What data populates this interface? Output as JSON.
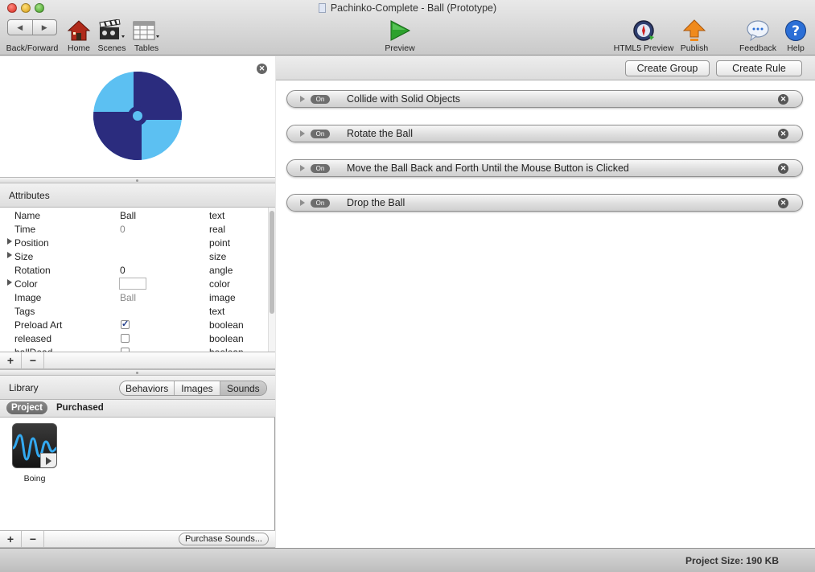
{
  "window": {
    "title": "Pachinko-Complete - Ball (Prototype)"
  },
  "toolbar": {
    "back_forward": "Back/Forward",
    "home": "Home",
    "scenes": "Scenes",
    "tables": "Tables",
    "preview": "Preview",
    "html5_preview": "HTML5 Preview",
    "publish": "Publish",
    "feedback": "Feedback",
    "help": "Help"
  },
  "attributes": {
    "header": "Attributes",
    "rows": [
      {
        "name": "Name",
        "value": "Ball",
        "type": "text"
      },
      {
        "name": "Time",
        "value": "0",
        "type": "real"
      },
      {
        "name": "Position",
        "value": "",
        "type": "point"
      },
      {
        "name": "Size",
        "value": "",
        "type": "size"
      },
      {
        "name": "Rotation",
        "value": "0",
        "type": "angle"
      },
      {
        "name": "Color",
        "value": "",
        "type": "color"
      },
      {
        "name": "Image",
        "value": "Ball",
        "type": "image"
      },
      {
        "name": "Tags",
        "value": "",
        "type": "text"
      },
      {
        "name": "Preload Art",
        "value": "checked",
        "type": "boolean"
      },
      {
        "name": "released",
        "value": "unchecked",
        "type": "boolean"
      },
      {
        "name": "ballDead",
        "value": "unchecked",
        "type": "boolean"
      }
    ]
  },
  "buttons": {
    "add": "+",
    "remove": "−"
  },
  "library": {
    "header": "Library",
    "tabs": [
      "Behaviors",
      "Images",
      "Sounds"
    ],
    "selected_tab": "Sounds",
    "scope": [
      "Project",
      "Purchased"
    ],
    "selected_scope": "Project",
    "items": [
      {
        "label": "Boing"
      }
    ],
    "purchase_button": "Purchase Sounds..."
  },
  "rules_toolbar": {
    "create_group": "Create Group",
    "create_rule": "Create Rule"
  },
  "rules": [
    {
      "name": "Collide with Solid Objects",
      "state": "On"
    },
    {
      "name": "Rotate the Ball",
      "state": "On"
    },
    {
      "name": "Move the Ball Back and Forth Until the Mouse Button is Clicked",
      "state": "On"
    },
    {
      "name": "Drop the Ball",
      "state": "On"
    }
  ],
  "status": {
    "project_size": "Project Size: 190 KB"
  },
  "colors": {
    "ball_dark": "#2b2c7e",
    "ball_light": "#5cc0f2",
    "preview_green": "#2da12d",
    "publish_orange": "#f08a1c",
    "help_blue": "#2c6fd6"
  },
  "icons": {
    "home": "house-icon",
    "scenes": "clapperboard-icon",
    "tables": "table-icon",
    "preview": "play-icon",
    "html5_preview": "compass-icon",
    "publish": "upload-arrow-icon",
    "feedback": "speech-bubble-icon",
    "help": "question-mark-icon"
  }
}
